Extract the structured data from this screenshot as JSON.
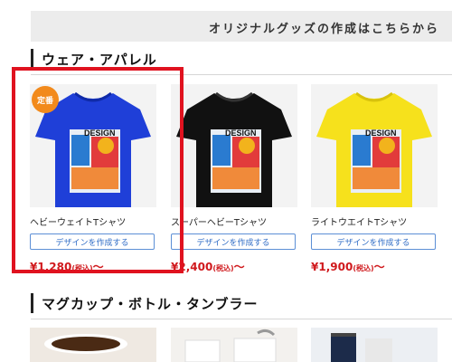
{
  "banner": {
    "text": "オリジナルグッズの作成はこちらから"
  },
  "sections": [
    {
      "title": "ウェア・アパレル"
    },
    {
      "title": "マグカップ・ボトル・タンブラー"
    }
  ],
  "products": [
    {
      "name": "ヘビーウェイトTシャツ",
      "button": "デザインを作成する",
      "price": "¥1,280",
      "tax": "(税込)",
      "suffix": "〜",
      "badge": "定番",
      "color": "#1f3fd8"
    },
    {
      "name": "スーパーヘビーTシャツ",
      "button": "デザインを作成する",
      "price": "¥2,400",
      "tax": "(税込)",
      "suffix": "〜",
      "color": "#111111"
    },
    {
      "name": "ライトウエイトTシャツ",
      "button": "デザインを作成する",
      "price": "¥1,900",
      "tax": "(税込)",
      "suffix": "〜",
      "color": "#f6e11c"
    }
  ],
  "print_text": "DESIGN",
  "colors": {
    "accent_red": "#d0191d",
    "button_blue": "#2f6cc6",
    "highlight": "#e0121f",
    "badge": "#f28a1c"
  }
}
